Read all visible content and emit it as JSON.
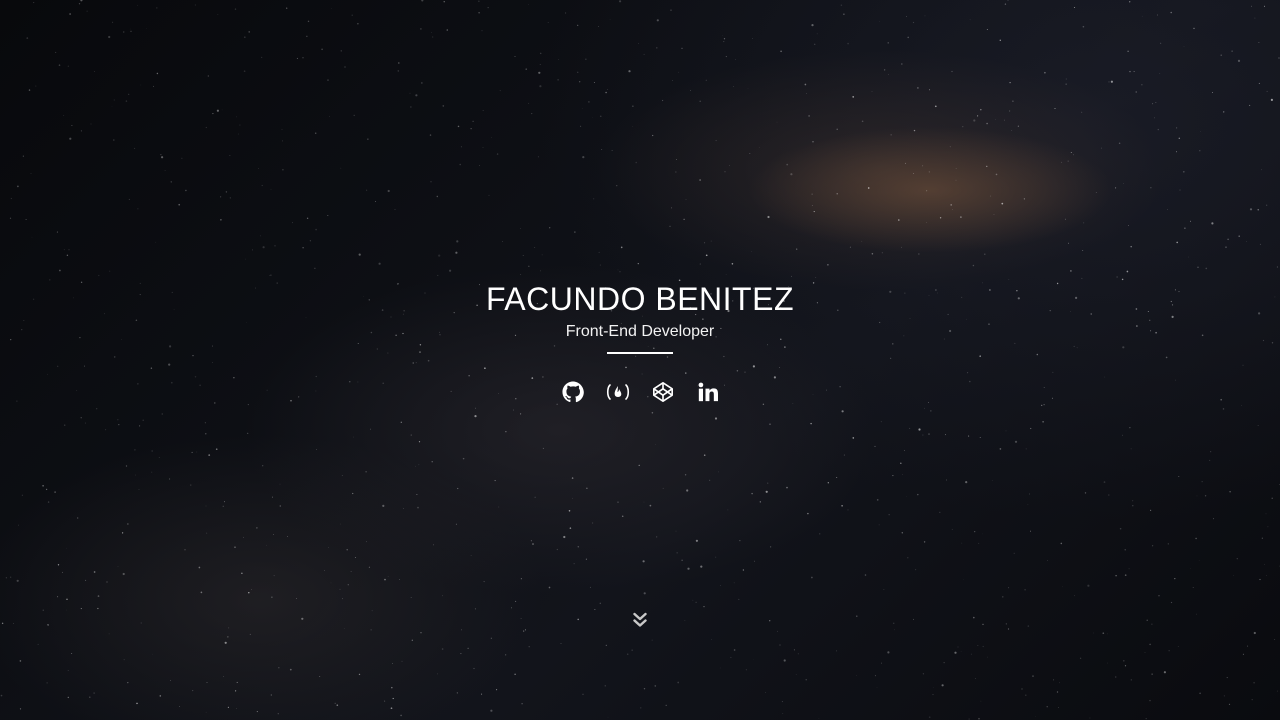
{
  "hero": {
    "name": "FACUNDO BENITEZ",
    "role": "Front-End Developer"
  },
  "socials": [
    {
      "icon": "github-icon"
    },
    {
      "icon": "freecodecamp-icon"
    },
    {
      "icon": "codepen-icon"
    },
    {
      "icon": "linkedin-icon"
    }
  ],
  "scroll": {
    "icon": "double-chevron-down-icon"
  },
  "colors": {
    "text": "#ffffff",
    "background": "#0b0c10",
    "nebula": "#785538"
  }
}
